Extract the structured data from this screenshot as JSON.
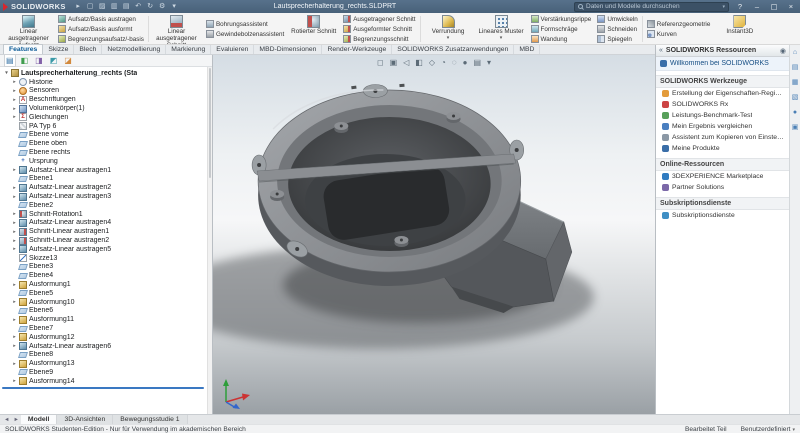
{
  "title_bar": {
    "app_name": "SOLIDWORKS",
    "file_name": "Lautsprecherhalterung_rechts.SLDPRT",
    "search_placeholder": "Daten und Modelle durchsuchen",
    "help_label": "?",
    "toolbar_icons": [
      {
        "glyph": "▸",
        "name": "menu-arrow-icon"
      },
      {
        "glyph": "▢",
        "name": "new-document-icon"
      },
      {
        "glyph": "▨",
        "name": "open-icon"
      },
      {
        "glyph": "▥",
        "name": "save-icon"
      },
      {
        "glyph": "▤",
        "name": "print-icon"
      },
      {
        "glyph": "↶",
        "name": "undo-icon"
      },
      {
        "glyph": "↻",
        "name": "rebuild-icon"
      },
      {
        "glyph": "⚙",
        "name": "options-icon"
      },
      {
        "glyph": "▾",
        "name": "toolbar-dropdown-icon"
      }
    ],
    "window_buttons": [
      {
        "glyph": "–",
        "name": "minimize-button"
      },
      {
        "glyph": "▢",
        "name": "restore-button"
      },
      {
        "glyph": "×",
        "name": "close-button"
      }
    ]
  },
  "ribbon": {
    "tabs": [
      {
        "label": "Features",
        "cls": "active",
        "name": "tab-features"
      },
      {
        "label": "Skizze",
        "cls": "",
        "name": "tab-skizze"
      },
      {
        "label": "Blech",
        "cls": "",
        "name": "tab-blech"
      },
      {
        "label": "Netzmodellierung",
        "cls": "",
        "name": "tab-netzmodellierung"
      },
      {
        "label": "Markierung",
        "cls": "",
        "name": "tab-markierung"
      },
      {
        "label": "Evaluieren",
        "cls": "",
        "name": "tab-evaluieren"
      },
      {
        "label": "MBD-Dimensionen",
        "cls": "",
        "name": "tab-mbd-dimensionen"
      },
      {
        "label": "Render-Werkzeuge",
        "cls": "",
        "name": "tab-render-werkzeuge"
      },
      {
        "label": "SOLIDWORKS Zusatzanwendungen",
        "cls": "",
        "name": "tab-zusatzanwendungen"
      },
      {
        "label": "MBD",
        "cls": "",
        "name": "tab-mbd"
      }
    ],
    "big_buttons": {
      "extrude_boss": "Linear ausgetragener Aufsatz",
      "extruded_cut": "Linear ausgetragener Schnitt",
      "revolved_cut": "Rotierter Schnitt",
      "fillet": "Verrundung",
      "linear_pattern": "Lineares Muster",
      "instant3d": "Instant3D"
    },
    "stacks": {
      "boss": [
        {
          "label": "Aufsatz/Basis austragen",
          "icon": "revolved-boss-icon"
        },
        {
          "label": "Aufsatz/Basis ausformt",
          "icon": "lofted-boss-icon"
        },
        {
          "label": "Begrenzungsaufsatz/-basis",
          "icon": "boundary-boss-icon"
        }
      ],
      "holes": [
        {
          "label": "Bohrungsassistent",
          "icon": "hole-wizard-icon"
        },
        {
          "label": "Gewindebolzenassistent",
          "icon": "stud-wizard-icon"
        }
      ],
      "cuts": [
        {
          "label": "Ausgetragener Schnitt",
          "icon": "swept-cut-icon"
        },
        {
          "label": "Ausgeformter Schnitt",
          "icon": "lofted-cut-icon"
        },
        {
          "label": "Begrenzungsschnitt",
          "icon": "boundary-cut-icon"
        }
      ],
      "features": [
        {
          "label": "Verstärkungsrippe",
          "icon": "rib-icon"
        },
        {
          "label": "Formschräge",
          "icon": "draft-icon"
        },
        {
          "label": "Wandung",
          "icon": "shell-icon"
        }
      ],
      "modify": [
        {
          "label": "Umwickeln",
          "icon": "wrap-icon"
        },
        {
          "label": "Schneiden",
          "icon": "intersect-icon"
        },
        {
          "label": "Spiegeln",
          "icon": "mirror-icon"
        }
      ],
      "reference": [
        {
          "label": "Referenzgeometrie",
          "icon": "reference-geometry-icon"
        },
        {
          "label": "Kurven",
          "icon": "curves-icon"
        }
      ]
    }
  },
  "left_panel": {
    "tab_icons": [
      {
        "glyph": "▤",
        "cls": "feature-manager-tab-icon active",
        "name": "feature-manager-tab"
      },
      {
        "glyph": "◧",
        "cls": "property-manager-tab-icon",
        "name": "property-manager-tab"
      },
      {
        "glyph": "◨",
        "cls": "configuration-manager-tab-icon",
        "name": "configuration-manager-tab"
      },
      {
        "glyph": "◩",
        "cls": "dimxpert-manager-tab-icon",
        "name": "dimxpert-manager-tab"
      },
      {
        "glyph": "◪",
        "cls": "display-manager-tab-icon",
        "name": "display-manager-tab"
      }
    ]
  },
  "feature_tree": {
    "items": [
      {
        "label": "Lautsprecherhalterung_rechts (Sta",
        "icon": "part-icon",
        "arrow": "▾",
        "cls": "root"
      },
      {
        "label": "Historie",
        "icon": "history-icon",
        "arrow": "▸",
        "cls": ""
      },
      {
        "label": "Sensoren",
        "icon": "sensors-icon",
        "arrow": "▸",
        "cls": ""
      },
      {
        "label": "Beschriftungen",
        "icon": "annotations-icon",
        "arrow": "▸",
        "cls": ""
      },
      {
        "label": "Volumenkörper(1)",
        "icon": "solid-bodies-icon",
        "arrow": "▸",
        "cls": ""
      },
      {
        "label": "Gleichungen",
        "icon": "equations-icon",
        "arrow": "▸",
        "cls": ""
      },
      {
        "label": "PA Typ 6",
        "icon": "material-icon",
        "arrow": "",
        "cls": ""
      },
      {
        "label": "Ebene vorne",
        "icon": "plane-icon",
        "arrow": "",
        "cls": ""
      },
      {
        "label": "Ebene oben",
        "icon": "plane-icon",
        "arrow": "",
        "cls": ""
      },
      {
        "label": "Ebene rechts",
        "icon": "plane-icon",
        "arrow": "",
        "cls": ""
      },
      {
        "label": "Ursprung",
        "icon": "origin-icon",
        "arrow": "",
        "cls": ""
      },
      {
        "label": "Aufsatz-Linear austragen1",
        "icon": "extrude-icon",
        "arrow": "▸",
        "cls": ""
      },
      {
        "label": "Ebene1",
        "icon": "plane-icon",
        "arrow": "",
        "cls": ""
      },
      {
        "label": "Aufsatz-Linear austragen2",
        "icon": "extrude-icon",
        "arrow": "▸",
        "cls": ""
      },
      {
        "label": "Aufsatz-Linear austragen3",
        "icon": "extrude-icon",
        "arrow": "▸",
        "cls": ""
      },
      {
        "label": "Ebene2",
        "icon": "plane-icon",
        "arrow": "",
        "cls": ""
      },
      {
        "label": "Schnitt-Rotation1",
        "icon": "revolved-cut-icon",
        "arrow": "▸",
        "cls": ""
      },
      {
        "label": "Aufsatz-Linear austragen4",
        "icon": "extrude-icon",
        "arrow": "▸",
        "cls": ""
      },
      {
        "label": "Schnitt-Linear austragen1",
        "icon": "cut-icon",
        "arrow": "▸",
        "cls": ""
      },
      {
        "label": "Schnitt-Linear austragen2",
        "icon": "cut-icon",
        "arrow": "▸",
        "cls": ""
      },
      {
        "label": "Aufsatz-Linear austragen5",
        "icon": "extrude-icon",
        "arrow": "▸",
        "cls": ""
      },
      {
        "label": "Skizze13",
        "icon": "sketch-icon",
        "arrow": "",
        "cls": ""
      },
      {
        "label": "Ebene3",
        "icon": "plane-icon",
        "arrow": "",
        "cls": ""
      },
      {
        "label": "Ebene4",
        "icon": "plane-icon",
        "arrow": "",
        "cls": ""
      },
      {
        "label": "Ausformung1",
        "icon": "loft-icon",
        "arrow": "▸",
        "cls": ""
      },
      {
        "label": "Ebene5",
        "icon": "plane-icon",
        "arrow": "",
        "cls": ""
      },
      {
        "label": "Ausformung10",
        "icon": "loft-icon",
        "arrow": "▸",
        "cls": ""
      },
      {
        "label": "Ebene6",
        "icon": "plane-icon",
        "arrow": "",
        "cls": ""
      },
      {
        "label": "Ausformung11",
        "icon": "loft-icon",
        "arrow": "▸",
        "cls": ""
      },
      {
        "label": "Ebene7",
        "icon": "plane-icon",
        "arrow": "",
        "cls": ""
      },
      {
        "label": "Ausformung12",
        "icon": "loft-icon",
        "arrow": "▸",
        "cls": ""
      },
      {
        "label": "Aufsatz-Linear austragen6",
        "icon": "extrude-icon",
        "arrow": "▸",
        "cls": ""
      },
      {
        "label": "Ebene8",
        "icon": "plane-icon",
        "arrow": "",
        "cls": ""
      },
      {
        "label": "Ausformung13",
        "icon": "loft-icon",
        "arrow": "▸",
        "cls": ""
      },
      {
        "label": "Ebene9",
        "icon": "plane-icon",
        "arrow": "",
        "cls": ""
      },
      {
        "label": "Ausformung14",
        "icon": "loft-icon",
        "arrow": "▸",
        "cls": ""
      }
    ]
  },
  "viewport": {
    "hud_icons": [
      {
        "glyph": "◻",
        "name": "zoom-fit-icon"
      },
      {
        "glyph": "▣",
        "name": "zoom-area-icon"
      },
      {
        "glyph": "◁",
        "name": "previous-view-icon"
      },
      {
        "glyph": "◧",
        "name": "section-view-icon"
      },
      {
        "glyph": "◇",
        "name": "view-orientation-icon"
      },
      {
        "glyph": "◔",
        "name": "display-style-icon"
      },
      {
        "glyph": "◌",
        "name": "hide-show-items-icon"
      },
      {
        "glyph": "●",
        "name": "edit-appearance-icon"
      },
      {
        "glyph": "▤",
        "name": "apply-scene-icon"
      },
      {
        "glyph": "▾",
        "name": "view-settings-icon"
      }
    ]
  },
  "task_pane": {
    "title": "SOLIDWORKS Ressourcen",
    "collapse_glyph": "«",
    "pin_glyph": "◉",
    "welcome": {
      "label": "Willkommen bei SOLIDWORKS"
    },
    "sections": [
      {
        "title": "SOLIDWORKS Werkzeuge",
        "items": [
          {
            "label": "Erstellung der Eigenschaften-Registerkarte",
            "icon": "property-tab-builder-icon"
          },
          {
            "label": "SOLIDWORKS Rx",
            "icon": "solidworks-rx-icon"
          },
          {
            "label": "Leistungs-Benchmark-Test",
            "icon": "performance-benchmark-icon"
          },
          {
            "label": "Mein Ergebnis vergleichen",
            "icon": "compare-results-icon"
          },
          {
            "label": "Assistent zum Kopieren von Einstellungen",
            "icon": "copy-settings-wizard-icon"
          },
          {
            "label": "Meine Produkte",
            "icon": "my-products-icon"
          }
        ]
      },
      {
        "title": "Online-Ressourcen",
        "items": [
          {
            "label": "3DEXPERIENCE Marketplace",
            "icon": "marketplace-icon"
          },
          {
            "label": "Partner Solutions",
            "icon": "partner-solutions-icon"
          }
        ]
      },
      {
        "title": "Subskriptionsdienste",
        "items": [
          {
            "label": "Subskriptionsdienste",
            "icon": "subscription-services-icon"
          }
        ]
      }
    ],
    "strip_icons": [
      {
        "glyph": "⌂",
        "name": "solidworks-resources-tab-icon"
      },
      {
        "glyph": "▤",
        "name": "design-library-tab-icon"
      },
      {
        "glyph": "▦",
        "name": "file-explorer-tab-icon"
      },
      {
        "glyph": "▧",
        "name": "view-palette-tab-icon"
      },
      {
        "glyph": "●",
        "name": "appearances-scenes-tab-icon"
      },
      {
        "glyph": "▣",
        "name": "custom-properties-tab-icon"
      }
    ]
  },
  "bottom_tabs": {
    "nav_icons": [
      {
        "glyph": "◄",
        "name": "tab-scroll-left-icon"
      },
      {
        "glyph": "►",
        "name": "tab-scroll-right-icon"
      }
    ],
    "tabs": [
      {
        "label": "Modell",
        "cls": "active",
        "name": "tab-modell"
      },
      {
        "label": "3D-Ansichten",
        "cls": "",
        "name": "tab-3d-ansichten"
      },
      {
        "label": "Bewegungsstudie 1",
        "cls": "",
        "name": "tab-bewegungsstudie-1"
      }
    ]
  },
  "status_bar": {
    "left": "SOLIDWORKS Studenten-Edition - Nur für Verwendung im akademischen Bereich",
    "mode": "Bearbeitet Teil",
    "units": "Benutzerdefiniert"
  }
}
